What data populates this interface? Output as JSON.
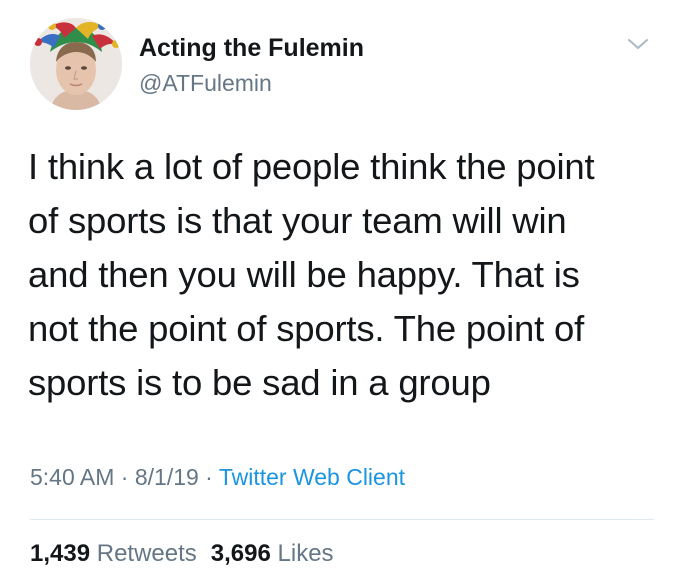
{
  "user": {
    "display_name": "Acting the Fulemin",
    "handle": "@ATFulemin",
    "avatar_icon": "avatar-jester-hat",
    "menu_icon": "chevron-down-icon"
  },
  "tweet": {
    "lines": [
      "I think a lot of people think the point",
      "of sports is that your team will win",
      "and then you will be happy. That is",
      "not the point of sports. The point of",
      "sports is to be sad in a group"
    ]
  },
  "meta": {
    "time": "5:40 AM",
    "separator": " · ",
    "date": "8/1/19",
    "source": "Twitter Web Client"
  },
  "stats": {
    "retweets_count": "1,439",
    "retweets_label": "Retweets",
    "likes_count": "3,696",
    "likes_label": "Likes"
  },
  "colors": {
    "text": "#14171a",
    "secondary": "#657786",
    "link": "#1b95e0",
    "divider": "#e1e8ed"
  }
}
